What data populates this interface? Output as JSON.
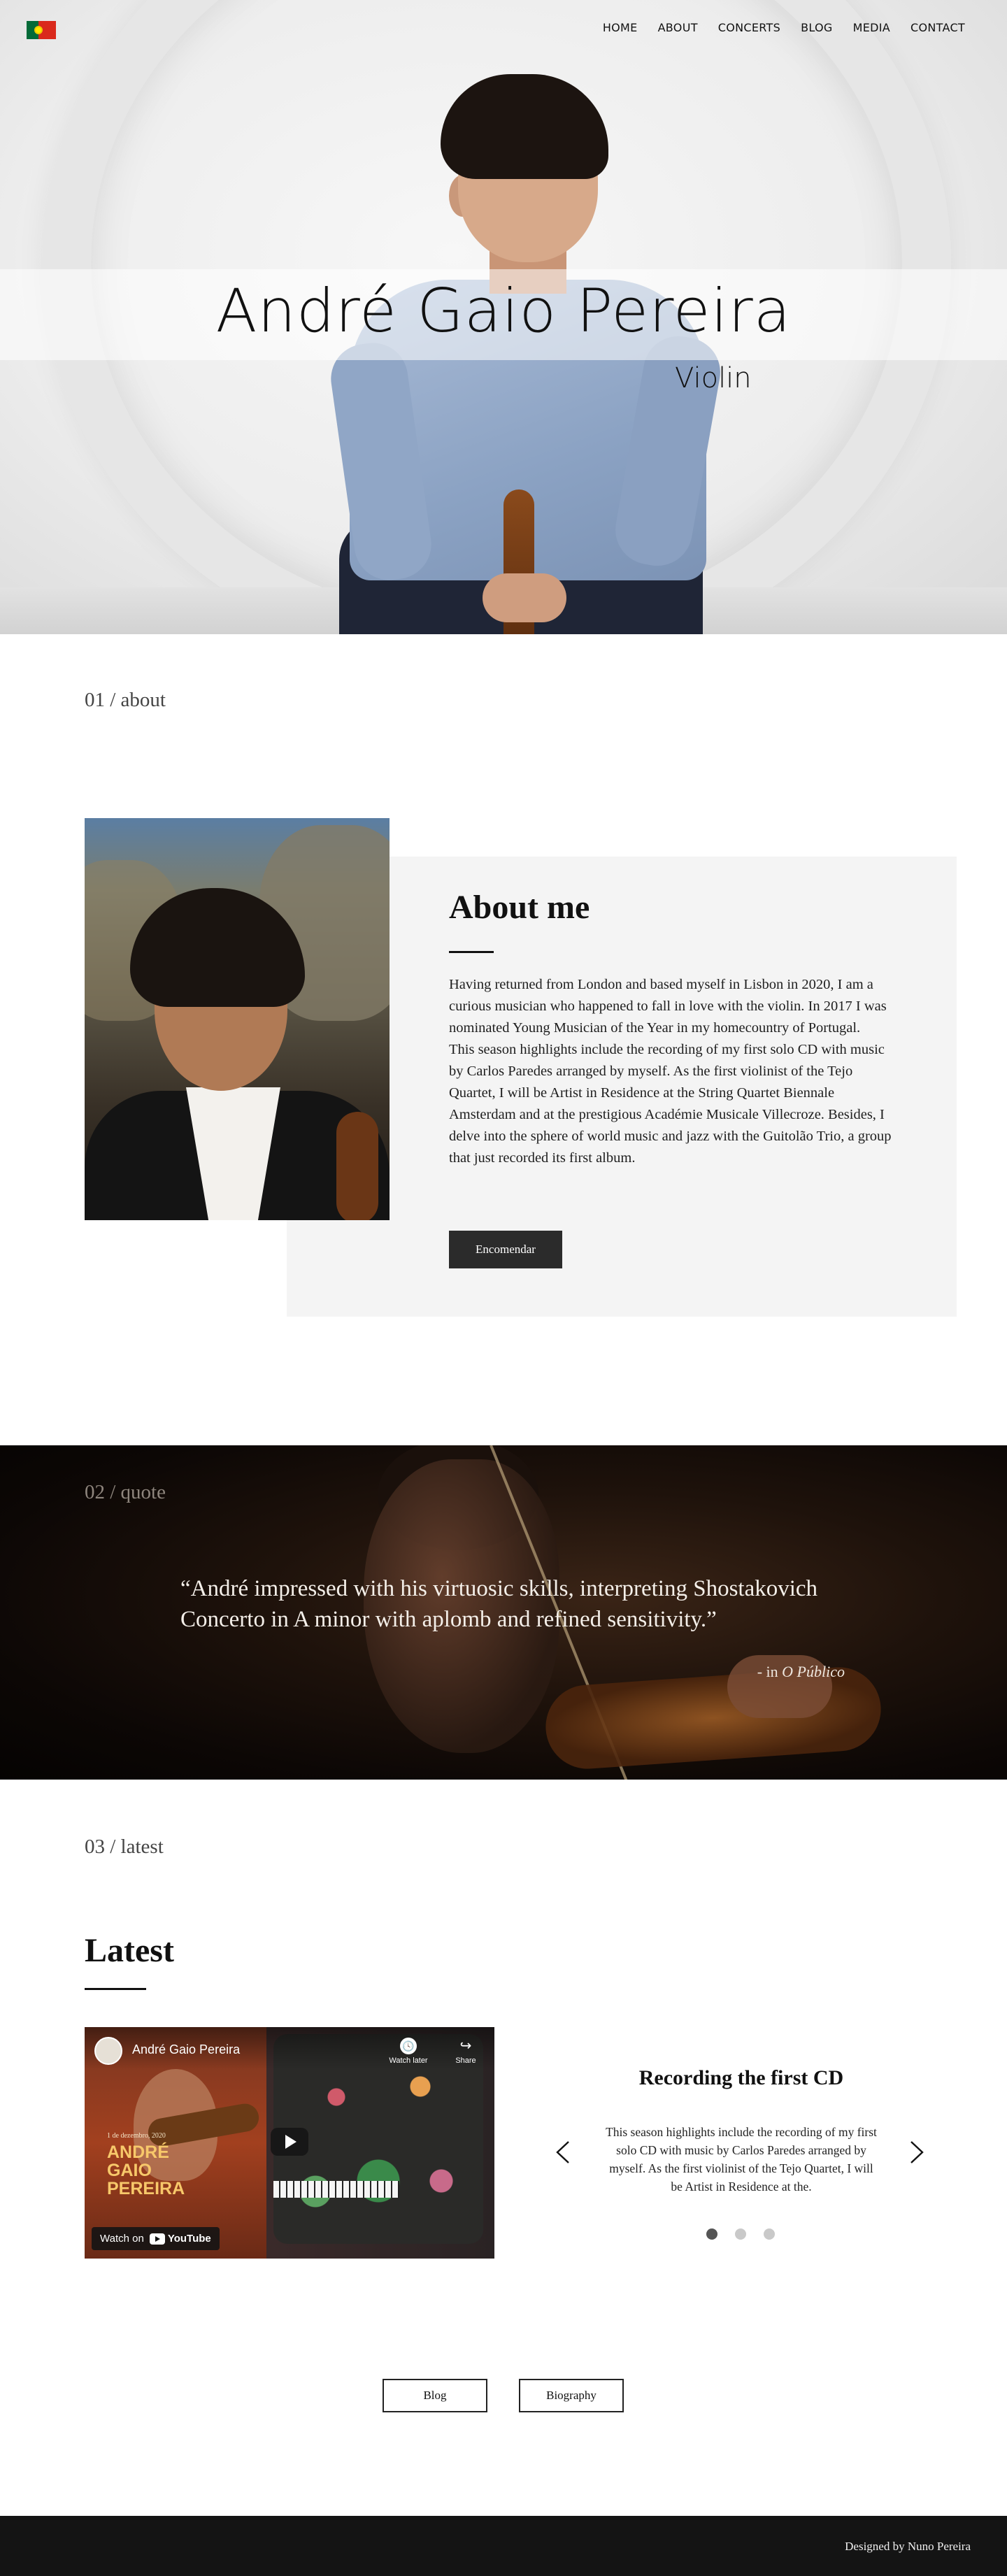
{
  "nav": {
    "flag": "portugal-flag",
    "items": [
      "HOME",
      "ABOUT",
      "CONCERTS",
      "BLOG",
      "MEDIA",
      "CONTACT"
    ]
  },
  "hero": {
    "name": "André Gaio Pereira",
    "role": "Violin"
  },
  "about": {
    "section_label": "01 / about",
    "title": "About me",
    "paragraphs": [
      "Having returned from London and based myself in Lisbon in 2020, I am a curious musician who happened to fall in love with the violin. In 2017 I was nominated Young Musician of the Year in my homecountry of Portugal.",
      "This season highlights include the recording of my first solo CD with music by Carlos Paredes arranged by myself. As the first violinist of the Tejo Quartet, I will be Artist in Residence at the String Quartet Biennale Amsterdam and at the prestigious Académie Musicale Villecroze. Besides, I delve into the sphere of world music and jazz with the Guitolão Trio, a group that just recorded its first album."
    ],
    "button": "Encomendar"
  },
  "quote": {
    "section_label": "02 / quote",
    "text": "“André impressed with his virtuosic skills, interpreting Shostakovich Concerto in A minor with aplomb and refined sensitivity.”",
    "source_prefix": "- in ",
    "source": "O Público"
  },
  "latest": {
    "section_label": "03 / latest",
    "title": "Latest",
    "video": {
      "channel": "André Gaio Pereira",
      "watch_later": "Watch later",
      "share": "Share",
      "overlay_date": "1 de dezembro, 2020",
      "overlay_name": "ANDRÉ GAIO PEREIRA",
      "watch_on": "Watch on",
      "platform": "YouTube"
    },
    "card": {
      "title": "Recording the first CD",
      "text": "This season highlights include the recording of my first solo CD with music by Carlos Paredes arranged by myself. As the first violinist of the Tejo Quartet, I will be Artist in Residence at the."
    },
    "slides": 3,
    "active_slide": 1
  },
  "buttons": {
    "blog": "Blog",
    "biography": "Biography"
  },
  "footer": {
    "credit": "Designed by Nuno Pereira"
  }
}
